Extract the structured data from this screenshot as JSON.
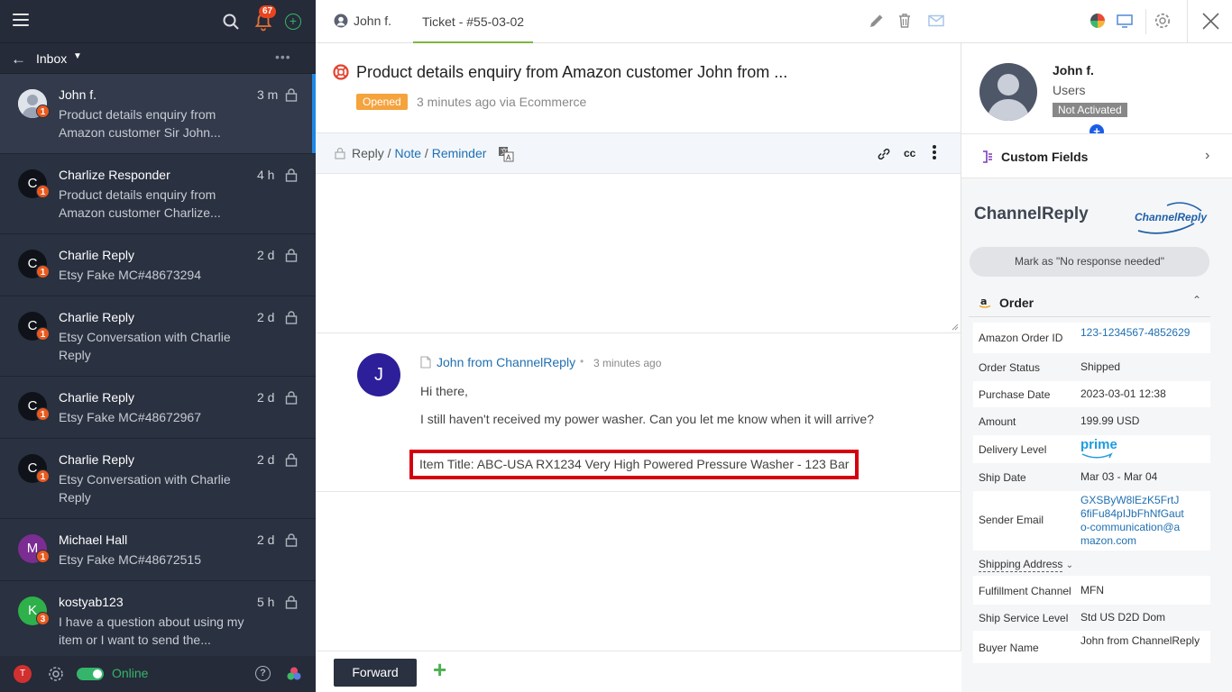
{
  "left": {
    "notification_count": "67",
    "inbox_label": "Inbox",
    "conversations": [
      {
        "name": "John f.",
        "time": "3 m",
        "badge": "1",
        "message": "Product details enquiry from Amazon customer Sir John...",
        "avatar_letter": ""
      },
      {
        "name": "Charlize Responder",
        "time": "4 h",
        "badge": "1",
        "message": "Product details enquiry from Amazon customer Charlize...",
        "avatar_letter": "C"
      },
      {
        "name": "Charlie Reply",
        "time": "2 d",
        "badge": "1",
        "message": "Etsy Fake MC#48673294",
        "avatar_letter": "C"
      },
      {
        "name": "Charlie Reply",
        "time": "2 d",
        "badge": "1",
        "message": "Etsy Conversation with Charlie Reply",
        "avatar_letter": "C"
      },
      {
        "name": "Charlie Reply",
        "time": "2 d",
        "badge": "1",
        "message": "Etsy Fake MC#48672967",
        "avatar_letter": "C"
      },
      {
        "name": "Charlie Reply",
        "time": "2 d",
        "badge": "1",
        "message": "Etsy Conversation with Charlie Reply",
        "avatar_letter": "C"
      },
      {
        "name": "Michael Hall",
        "time": "2 d",
        "badge": "1",
        "message": "Etsy Fake MC#48672515",
        "avatar_letter": "M"
      },
      {
        "name": "kostyab123",
        "time": "5 h",
        "badge": "3",
        "message": "I have a question about using my item or I want to send the...",
        "avatar_letter": "K"
      }
    ],
    "footer": {
      "user_initial": "T",
      "status": "Online"
    }
  },
  "topbar": {
    "user_tab": "John f.",
    "ticket_tab": "Ticket - #55-03-02"
  },
  "ticket": {
    "title": "Product details enquiry from Amazon customer John from ...",
    "status": "Opened",
    "subtitle": "3 minutes ago via Ecommerce"
  },
  "reply_bar": {
    "reply": "Reply",
    "sep1": " / ",
    "note": "Note",
    "sep2": " / ",
    "reminder": "Reminder",
    "cc": "cc"
  },
  "message": {
    "avatar_letter": "J",
    "from": "John from ChannelReply",
    "dot": "•",
    "time": "3 minutes ago",
    "greeting": "Hi there,",
    "body": "I still haven't received my power washer. Can you let me know when it will arrive?",
    "item_title": "Item Title: ABC-USA RX1234 Very High Powered Pressure Washer - 123 Bar"
  },
  "bottom": {
    "forward_label": "Forward",
    "add_label": "+"
  },
  "right": {
    "user": {
      "name": "John f.",
      "role": "Users",
      "status": "Not Activated",
      "add_label": "+"
    },
    "custom_fields_label": "Custom Fields",
    "channelreply_title": "ChannelReply",
    "logo_text": "ChannelReply",
    "mark_button": "Mark as \"No response needed\"",
    "order_label": "Order",
    "order_rows": [
      {
        "key": "Amazon Order ID",
        "value": "123-1234567-4852629",
        "link": true
      },
      {
        "key": "Order Status",
        "value": "Shipped",
        "link": false
      },
      {
        "key": "Purchase Date",
        "value": "2023-03-01 12:38",
        "link": false
      },
      {
        "key": "Amount",
        "value": "199.99 USD",
        "link": false
      },
      {
        "key": "Delivery Level",
        "value": "prime",
        "link": false
      },
      {
        "key": "Ship Date",
        "value": "Mar 03 - Mar 04",
        "link": false
      },
      {
        "key": "Sender Email",
        "value": "GXSByW8lEzK5FrtJ6fiFu84pIJbFhNfGauto-communication@amazon.com",
        "link": true
      },
      {
        "key": "Shipping Address",
        "value": "",
        "link": false
      },
      {
        "key": "Fulfillment Channel",
        "value": "MFN",
        "link": false
      },
      {
        "key": "Ship Service Level",
        "value": "Std US D2D Dom",
        "link": false
      },
      {
        "key": "Buyer Name",
        "value": "John from ChannelReply",
        "link": false
      }
    ]
  },
  "colors": {
    "sidebar_bg": "#2a3140",
    "accent_green": "#35b56b",
    "badge_orange": "#ea5a1e",
    "link_blue": "#1f6fb2",
    "opened_orange": "#f5a33d",
    "highlight_red": "#d5000f"
  }
}
